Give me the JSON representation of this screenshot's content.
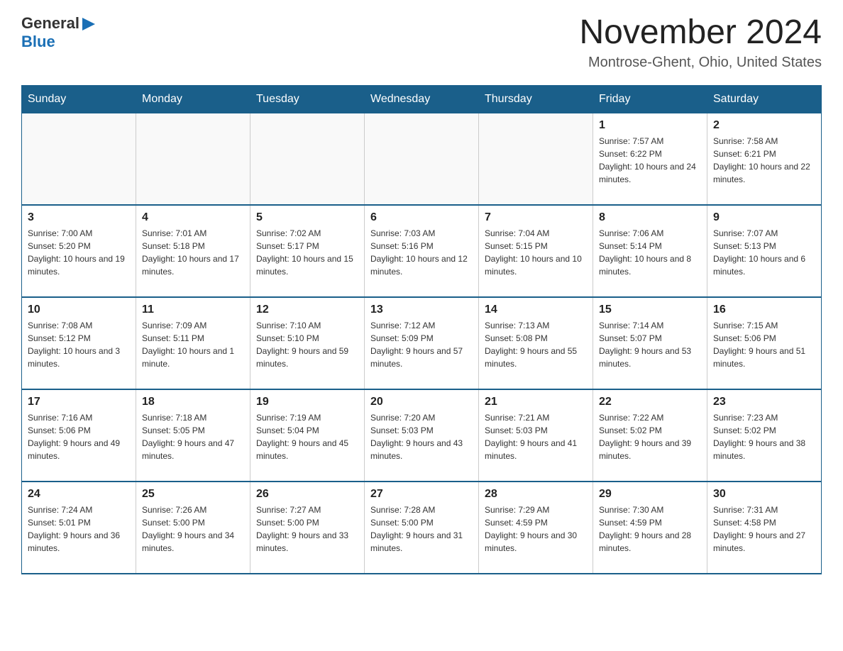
{
  "logo": {
    "text_general": "General",
    "text_blue": "Blue",
    "arrow": "▶"
  },
  "header": {
    "month": "November 2024",
    "location": "Montrose-Ghent, Ohio, United States"
  },
  "weekdays": [
    "Sunday",
    "Monday",
    "Tuesday",
    "Wednesday",
    "Thursday",
    "Friday",
    "Saturday"
  ],
  "weeks": [
    [
      {
        "day": "",
        "sunrise": "",
        "sunset": "",
        "daylight": ""
      },
      {
        "day": "",
        "sunrise": "",
        "sunset": "",
        "daylight": ""
      },
      {
        "day": "",
        "sunrise": "",
        "sunset": "",
        "daylight": ""
      },
      {
        "day": "",
        "sunrise": "",
        "sunset": "",
        "daylight": ""
      },
      {
        "day": "",
        "sunrise": "",
        "sunset": "",
        "daylight": ""
      },
      {
        "day": "1",
        "sunrise": "Sunrise: 7:57 AM",
        "sunset": "Sunset: 6:22 PM",
        "daylight": "Daylight: 10 hours and 24 minutes."
      },
      {
        "day": "2",
        "sunrise": "Sunrise: 7:58 AM",
        "sunset": "Sunset: 6:21 PM",
        "daylight": "Daylight: 10 hours and 22 minutes."
      }
    ],
    [
      {
        "day": "3",
        "sunrise": "Sunrise: 7:00 AM",
        "sunset": "Sunset: 5:20 PM",
        "daylight": "Daylight: 10 hours and 19 minutes."
      },
      {
        "day": "4",
        "sunrise": "Sunrise: 7:01 AM",
        "sunset": "Sunset: 5:18 PM",
        "daylight": "Daylight: 10 hours and 17 minutes."
      },
      {
        "day": "5",
        "sunrise": "Sunrise: 7:02 AM",
        "sunset": "Sunset: 5:17 PM",
        "daylight": "Daylight: 10 hours and 15 minutes."
      },
      {
        "day": "6",
        "sunrise": "Sunrise: 7:03 AM",
        "sunset": "Sunset: 5:16 PM",
        "daylight": "Daylight: 10 hours and 12 minutes."
      },
      {
        "day": "7",
        "sunrise": "Sunrise: 7:04 AM",
        "sunset": "Sunset: 5:15 PM",
        "daylight": "Daylight: 10 hours and 10 minutes."
      },
      {
        "day": "8",
        "sunrise": "Sunrise: 7:06 AM",
        "sunset": "Sunset: 5:14 PM",
        "daylight": "Daylight: 10 hours and 8 minutes."
      },
      {
        "day": "9",
        "sunrise": "Sunrise: 7:07 AM",
        "sunset": "Sunset: 5:13 PM",
        "daylight": "Daylight: 10 hours and 6 minutes."
      }
    ],
    [
      {
        "day": "10",
        "sunrise": "Sunrise: 7:08 AM",
        "sunset": "Sunset: 5:12 PM",
        "daylight": "Daylight: 10 hours and 3 minutes."
      },
      {
        "day": "11",
        "sunrise": "Sunrise: 7:09 AM",
        "sunset": "Sunset: 5:11 PM",
        "daylight": "Daylight: 10 hours and 1 minute."
      },
      {
        "day": "12",
        "sunrise": "Sunrise: 7:10 AM",
        "sunset": "Sunset: 5:10 PM",
        "daylight": "Daylight: 9 hours and 59 minutes."
      },
      {
        "day": "13",
        "sunrise": "Sunrise: 7:12 AM",
        "sunset": "Sunset: 5:09 PM",
        "daylight": "Daylight: 9 hours and 57 minutes."
      },
      {
        "day": "14",
        "sunrise": "Sunrise: 7:13 AM",
        "sunset": "Sunset: 5:08 PM",
        "daylight": "Daylight: 9 hours and 55 minutes."
      },
      {
        "day": "15",
        "sunrise": "Sunrise: 7:14 AM",
        "sunset": "Sunset: 5:07 PM",
        "daylight": "Daylight: 9 hours and 53 minutes."
      },
      {
        "day": "16",
        "sunrise": "Sunrise: 7:15 AM",
        "sunset": "Sunset: 5:06 PM",
        "daylight": "Daylight: 9 hours and 51 minutes."
      }
    ],
    [
      {
        "day": "17",
        "sunrise": "Sunrise: 7:16 AM",
        "sunset": "Sunset: 5:06 PM",
        "daylight": "Daylight: 9 hours and 49 minutes."
      },
      {
        "day": "18",
        "sunrise": "Sunrise: 7:18 AM",
        "sunset": "Sunset: 5:05 PM",
        "daylight": "Daylight: 9 hours and 47 minutes."
      },
      {
        "day": "19",
        "sunrise": "Sunrise: 7:19 AM",
        "sunset": "Sunset: 5:04 PM",
        "daylight": "Daylight: 9 hours and 45 minutes."
      },
      {
        "day": "20",
        "sunrise": "Sunrise: 7:20 AM",
        "sunset": "Sunset: 5:03 PM",
        "daylight": "Daylight: 9 hours and 43 minutes."
      },
      {
        "day": "21",
        "sunrise": "Sunrise: 7:21 AM",
        "sunset": "Sunset: 5:03 PM",
        "daylight": "Daylight: 9 hours and 41 minutes."
      },
      {
        "day": "22",
        "sunrise": "Sunrise: 7:22 AM",
        "sunset": "Sunset: 5:02 PM",
        "daylight": "Daylight: 9 hours and 39 minutes."
      },
      {
        "day": "23",
        "sunrise": "Sunrise: 7:23 AM",
        "sunset": "Sunset: 5:02 PM",
        "daylight": "Daylight: 9 hours and 38 minutes."
      }
    ],
    [
      {
        "day": "24",
        "sunrise": "Sunrise: 7:24 AM",
        "sunset": "Sunset: 5:01 PM",
        "daylight": "Daylight: 9 hours and 36 minutes."
      },
      {
        "day": "25",
        "sunrise": "Sunrise: 7:26 AM",
        "sunset": "Sunset: 5:00 PM",
        "daylight": "Daylight: 9 hours and 34 minutes."
      },
      {
        "day": "26",
        "sunrise": "Sunrise: 7:27 AM",
        "sunset": "Sunset: 5:00 PM",
        "daylight": "Daylight: 9 hours and 33 minutes."
      },
      {
        "day": "27",
        "sunrise": "Sunrise: 7:28 AM",
        "sunset": "Sunset: 5:00 PM",
        "daylight": "Daylight: 9 hours and 31 minutes."
      },
      {
        "day": "28",
        "sunrise": "Sunrise: 7:29 AM",
        "sunset": "Sunset: 4:59 PM",
        "daylight": "Daylight: 9 hours and 30 minutes."
      },
      {
        "day": "29",
        "sunrise": "Sunrise: 7:30 AM",
        "sunset": "Sunset: 4:59 PM",
        "daylight": "Daylight: 9 hours and 28 minutes."
      },
      {
        "day": "30",
        "sunrise": "Sunrise: 7:31 AM",
        "sunset": "Sunset: 4:58 PM",
        "daylight": "Daylight: 9 hours and 27 minutes."
      }
    ]
  ]
}
